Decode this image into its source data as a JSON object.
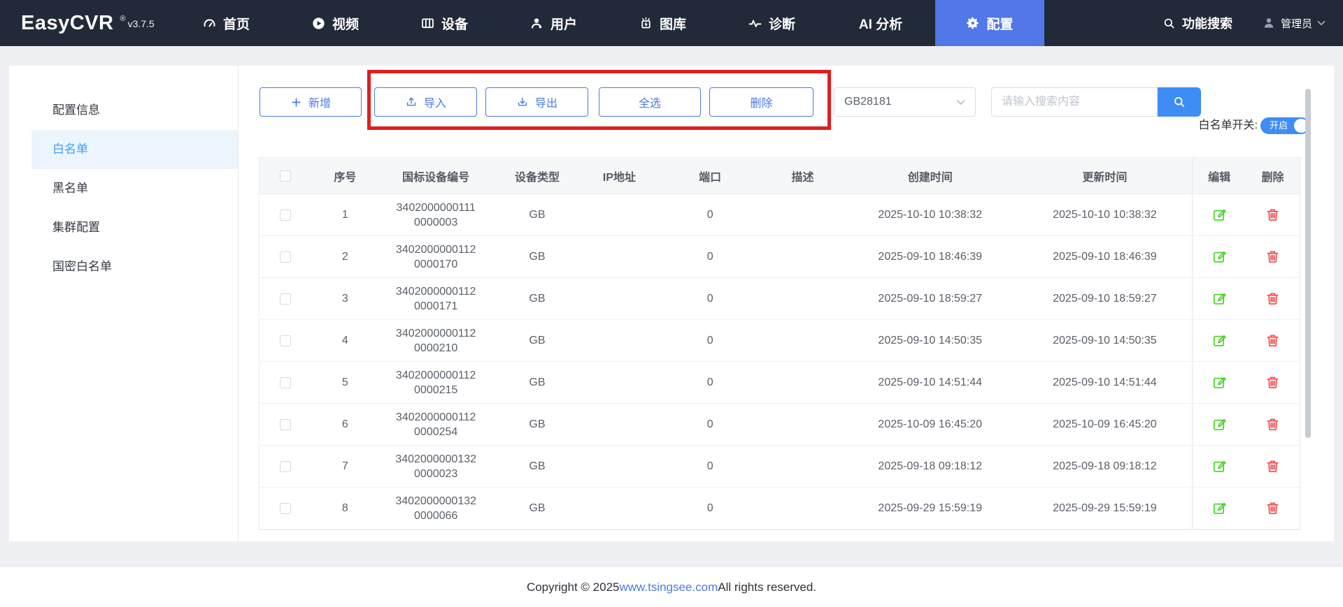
{
  "navbar": {
    "logo": "EasyCVR",
    "reg": "®",
    "version": "v3.7.5",
    "items": [
      {
        "label": "首页",
        "icon": "dashboard-icon"
      },
      {
        "label": "视频",
        "icon": "play-circle-icon"
      },
      {
        "label": "设备",
        "icon": "device-wall-icon"
      },
      {
        "label": "用户",
        "icon": "user-icon"
      },
      {
        "label": "图库",
        "icon": "gallery-icon"
      },
      {
        "label": "诊断",
        "icon": "pulse-icon"
      },
      {
        "label": "AI 分析",
        "icon": null
      },
      {
        "label": "配置",
        "icon": "gear-icon",
        "active": true
      }
    ],
    "search_label": "功能搜索",
    "user_label": "管理员"
  },
  "sidebar": {
    "items": [
      {
        "label": "配置信息"
      },
      {
        "label": "白名单",
        "active": true
      },
      {
        "label": "黑名单"
      },
      {
        "label": "集群配置"
      },
      {
        "label": "国密白名单"
      }
    ]
  },
  "toolbar": {
    "add": "新增",
    "import": "导入",
    "export": "导出",
    "select_all": "全选",
    "delete": "删除",
    "protocol_select": "GB28181",
    "search_placeholder": "请输入搜索内容",
    "switch_label": "白名单开关:",
    "switch_state": "开启"
  },
  "table": {
    "headers": [
      "序号",
      "国标设备编号",
      "设备类型",
      "IP地址",
      "端口",
      "描述",
      "创建时间",
      "更新时间",
      "编辑",
      "删除"
    ],
    "rows": [
      {
        "index": "1",
        "id_line1": "3402000000111",
        "id_line2": "0000003",
        "type": "GB",
        "ip": "",
        "port": "0",
        "desc": "",
        "created": "2025-10-10 10:38:32",
        "updated": "2025-10-10 10:38:32"
      },
      {
        "index": "2",
        "id_line1": "3402000000112",
        "id_line2": "0000170",
        "type": "GB",
        "ip": "",
        "port": "0",
        "desc": "",
        "created": "2025-09-10 18:46:39",
        "updated": "2025-09-10 18:46:39"
      },
      {
        "index": "3",
        "id_line1": "3402000000112",
        "id_line2": "0000171",
        "type": "GB",
        "ip": "",
        "port": "0",
        "desc": "",
        "created": "2025-09-10 18:59:27",
        "updated": "2025-09-10 18:59:27"
      },
      {
        "index": "4",
        "id_line1": "3402000000112",
        "id_line2": "0000210",
        "type": "GB",
        "ip": "",
        "port": "0",
        "desc": "",
        "created": "2025-09-10 14:50:35",
        "updated": "2025-09-10 14:50:35"
      },
      {
        "index": "5",
        "id_line1": "3402000000112",
        "id_line2": "0000215",
        "type": "GB",
        "ip": "",
        "port": "0",
        "desc": "",
        "created": "2025-09-10 14:51:44",
        "updated": "2025-09-10 14:51:44"
      },
      {
        "index": "6",
        "id_line1": "3402000000112",
        "id_line2": "0000254",
        "type": "GB",
        "ip": "",
        "port": "0",
        "desc": "",
        "created": "2025-10-09 16:45:20",
        "updated": "2025-10-09 16:45:20"
      },
      {
        "index": "7",
        "id_line1": "3402000000132",
        "id_line2": "0000023",
        "type": "GB",
        "ip": "",
        "port": "0",
        "desc": "",
        "created": "2025-09-18 09:18:12",
        "updated": "2025-09-18 09:18:12"
      },
      {
        "index": "8",
        "id_line1": "3402000000132",
        "id_line2": "0000066",
        "type": "GB",
        "ip": "",
        "port": "0",
        "desc": "",
        "created": "2025-09-29 15:59:19",
        "updated": "2025-09-29 15:59:19"
      }
    ]
  },
  "footer": {
    "prefix": "Copyright © 2025 ",
    "link": "www.tsingsee.com",
    "suffix": " All rights reserved."
  },
  "colors": {
    "nav-bg": "#212a38",
    "nav-active": "#5277e8",
    "accent": "#4a7be6",
    "primary": "#3e8df5",
    "edit-green": "#43d321",
    "delete-red": "#f54545",
    "annotation-red": "#e01e1e",
    "link-blue": "#4a7be6",
    "sidebar-active-bg": "#ecf5fd",
    "sidebar-active-text": "#409eff"
  }
}
